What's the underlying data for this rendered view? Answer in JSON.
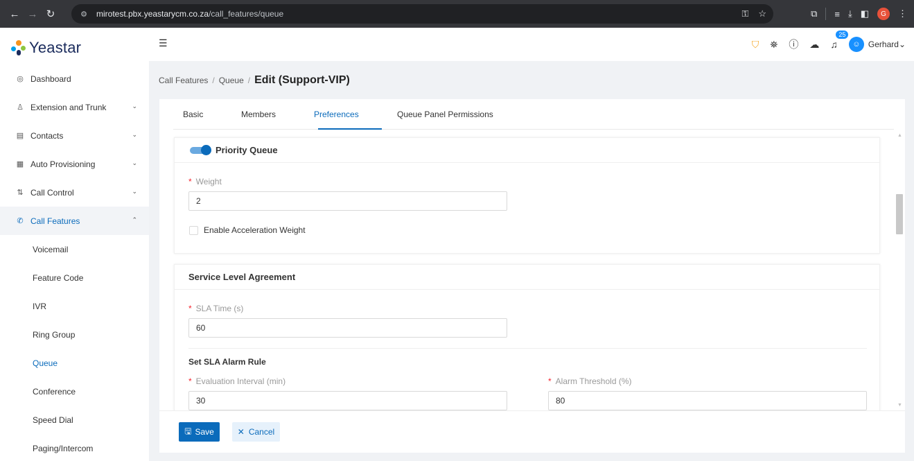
{
  "browser": {
    "url_host": "mirotest.pbx.yeastarycm.co.za",
    "url_path": "/call_features/queue",
    "profile_initial": "G"
  },
  "sidebar": {
    "logo_text": "Yeastar",
    "items": [
      {
        "label": "Dashboard",
        "icon": "dashboard-icon"
      },
      {
        "label": "Extension and Trunk",
        "icon": "user-list-icon"
      },
      {
        "label": "Contacts",
        "icon": "contacts-icon"
      },
      {
        "label": "Auto Provisioning",
        "icon": "provisioning-icon"
      },
      {
        "label": "Call Control",
        "icon": "sliders-icon"
      },
      {
        "label": "Call Features",
        "icon": "phone-icon"
      }
    ],
    "sub_items": [
      "Voicemail",
      "Feature Code",
      "IVR",
      "Ring Group",
      "Queue",
      "Conference",
      "Speed Dial",
      "Paging/Intercom"
    ]
  },
  "topbar": {
    "notification_count": "25",
    "user_name": "Gerhard"
  },
  "breadcrumb": {
    "level1": "Call Features",
    "level2": "Queue",
    "current": "Edit (Support-VIP)"
  },
  "tabs": [
    "Basic",
    "Members",
    "Preferences",
    "Queue Panel Permissions"
  ],
  "priority_queue": {
    "title": "Priority Queue",
    "enabled": true,
    "weight_label": "Weight",
    "weight_value": "2",
    "accel_label": "Enable Acceleration Weight",
    "accel_checked": false
  },
  "sla": {
    "title": "Service Level Agreement",
    "time_label": "SLA Time (s)",
    "time_value": "60",
    "alarm_rule_title": "Set SLA Alarm Rule",
    "interval_label": "Evaluation Interval (min)",
    "interval_value": "30",
    "threshold_label": "Alarm Threshold (%)",
    "threshold_value": "80"
  },
  "footer": {
    "save_label": "Save",
    "cancel_label": "Cancel"
  },
  "colors": {
    "accent": "#0b6bbb",
    "required": "#f5222d",
    "shield": "#f5a623"
  }
}
